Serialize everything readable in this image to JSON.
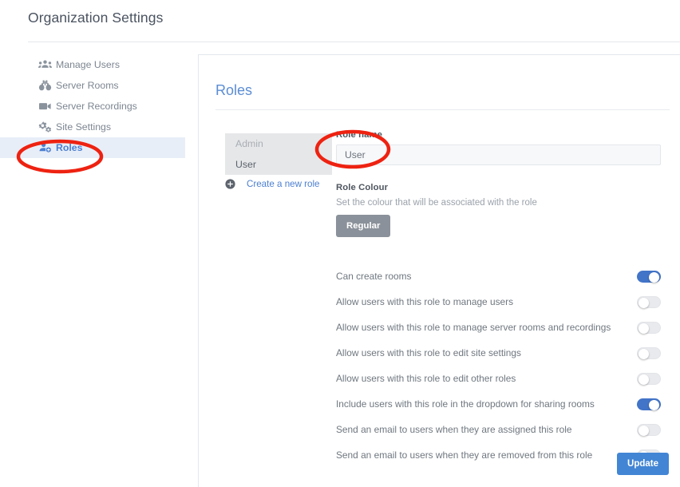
{
  "header": {
    "title": "Organization Settings"
  },
  "sidebar": {
    "items": [
      {
        "label": "Manage Users",
        "icon": "users-group-icon",
        "active": false
      },
      {
        "label": "Server Rooms",
        "icon": "binoculars-icon",
        "active": false
      },
      {
        "label": "Server Recordings",
        "icon": "video-camera-icon",
        "active": false
      },
      {
        "label": "Site Settings",
        "icon": "gears-icon",
        "active": false
      },
      {
        "label": "Roles",
        "icon": "user-add-icon",
        "active": true
      }
    ]
  },
  "panel": {
    "title": "Roles",
    "role_list": [
      {
        "label": "Admin",
        "state": "muted"
      },
      {
        "label": "User",
        "state": "current"
      }
    ],
    "create_role_link": "Create a new role",
    "create_role_icon": "circle-plus-icon",
    "form": {
      "role_name_label": "Role name",
      "role_name_value": "User",
      "role_name_placeholder": "Role name",
      "role_colour_label": "Role Colour",
      "role_colour_description": "Set the colour that will be associated with the role",
      "role_colour_button": "Regular"
    },
    "permissions": [
      {
        "label": "Can create rooms",
        "on": true
      },
      {
        "label": "Allow users with this role to manage users",
        "on": false
      },
      {
        "label": "Allow users with this role to manage server rooms and recordings",
        "on": false
      },
      {
        "label": "Allow users with this role to edit site settings",
        "on": false
      },
      {
        "label": "Allow users with this role to edit other roles",
        "on": false
      },
      {
        "label": "Include users with this role in the dropdown for sharing rooms",
        "on": true
      },
      {
        "label": "Send an email to users when they are assigned this role",
        "on": false
      },
      {
        "label": "Send an email to users when they are removed from this role",
        "on": false
      }
    ],
    "update_button": "Update"
  },
  "annotations": [
    {
      "name": "highlight-roles-nav",
      "shape": "ellipse",
      "colour": "#ee2211"
    },
    {
      "name": "highlight-role-name-field",
      "shape": "ellipse",
      "colour": "#ee2211"
    }
  ],
  "colours": {
    "accent_blue": "#4285d4",
    "toggle_on": "#4274c8",
    "toggle_off": "#e9eaee",
    "role_colour_grey": "#8b919a",
    "active_nav_bg": "#e8eef8",
    "annotation_red": "#ee2211"
  }
}
